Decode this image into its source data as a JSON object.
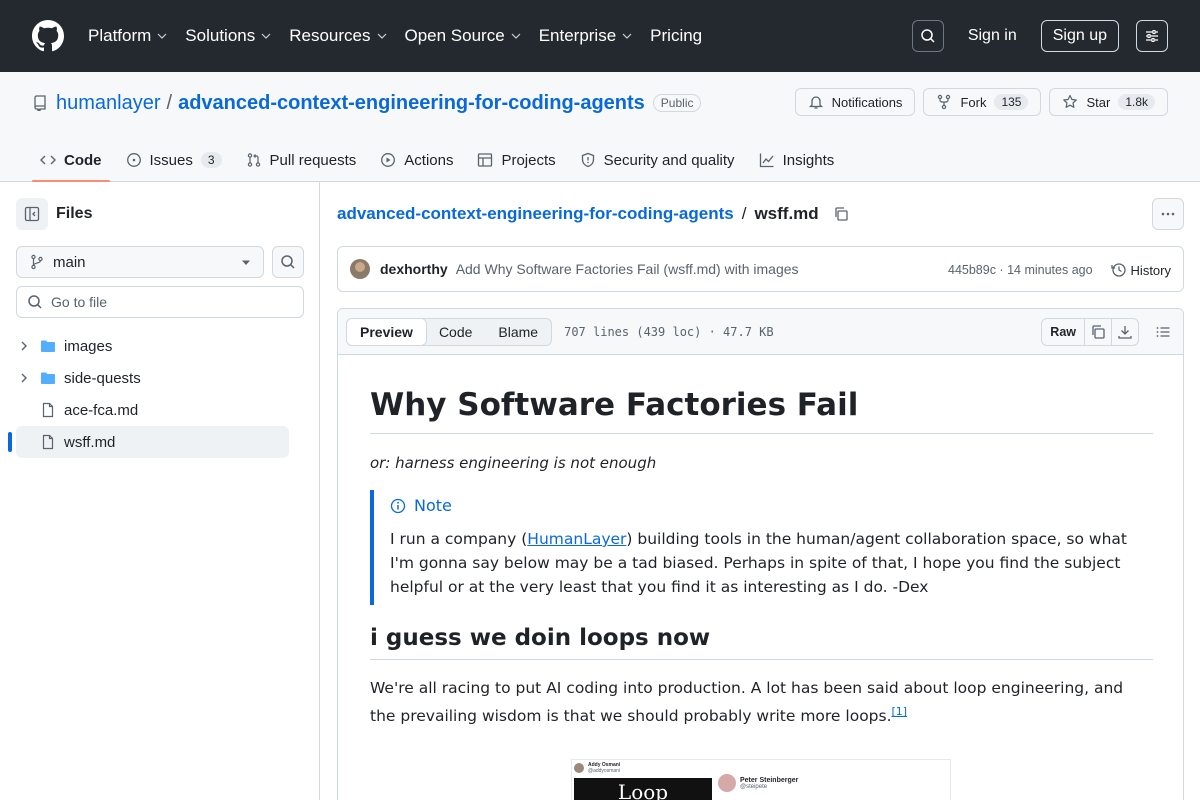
{
  "topnav": {
    "items": [
      "Platform",
      "Solutions",
      "Resources",
      "Open Source",
      "Enterprise",
      "Pricing"
    ],
    "has_dropdown": [
      true,
      true,
      true,
      true,
      true,
      false
    ],
    "signin": "Sign in",
    "signup": "Sign up"
  },
  "repo": {
    "owner": "humanlayer",
    "separator": "/",
    "name": "advanced-context-engineering-for-coding-agents",
    "visibility": "Public",
    "notifications_label": "Notifications",
    "fork_label": "Fork",
    "fork_count": "135",
    "star_label": "Star",
    "star_count": "1.8k"
  },
  "tabs": [
    {
      "label": "Code",
      "icon": "code-icon",
      "active": true
    },
    {
      "label": "Issues",
      "icon": "issue-icon",
      "count": "3"
    },
    {
      "label": "Pull requests",
      "icon": "pull-request-icon"
    },
    {
      "label": "Actions",
      "icon": "play-icon"
    },
    {
      "label": "Projects",
      "icon": "table-icon"
    },
    {
      "label": "Security and quality",
      "icon": "shield-icon"
    },
    {
      "label": "Insights",
      "icon": "graph-icon"
    }
  ],
  "sidebar": {
    "title": "Files",
    "branch": "main",
    "goto_placeholder": "Go to file",
    "tree": [
      {
        "name": "images",
        "type": "folder"
      },
      {
        "name": "side-quests",
        "type": "folder"
      },
      {
        "name": "ace-fca.md",
        "type": "file"
      },
      {
        "name": "wsff.md",
        "type": "file",
        "selected": true
      }
    ]
  },
  "file": {
    "breadcrumb_repo": "advanced-context-engineering-for-coding-agents",
    "breadcrumb_sep": "/",
    "filename": "wsff.md",
    "commit_author": "dexhorthy",
    "commit_message": "Add Why Software Factories Fail (wsff.md) with images",
    "commit_meta": "445b89c · 14 minutes ago",
    "history_label": "History",
    "view_tabs": [
      "Preview",
      "Code",
      "Blame"
    ],
    "meta": "707 lines (439 loc) · 47.7 KB",
    "raw_label": "Raw"
  },
  "content": {
    "h1": "Why Software Factories Fail",
    "subtitle": "or: harness engineering is not enough",
    "note_title": "Note",
    "note_pre": "I run a company (",
    "note_link": "HumanLayer",
    "note_post": ") building tools in the human/agent collaboration space, so what I'm gonna say below may be a tad biased. Perhaps in spite of that, I hope you find the subject helpful or at the very least that you find it as interesting as I do. -Dex",
    "h2": "i guess we doin loops now",
    "para": "We're all racing to put AI coding into production. A lot has been said about loop engineering, and the prevailing wisdom is that we should probably write more loops.",
    "footnote": "[1]",
    "image": {
      "left_name": "Addy Osmani",
      "left_handle": "@addyosmani",
      "loop_text": "Loop",
      "right_name": "Peter Steinberger",
      "right_handle": "@steipete"
    }
  },
  "colors": {
    "header_bg": "#24292f",
    "link": "#0969da",
    "active_tab_underline": "#fd8c73"
  }
}
